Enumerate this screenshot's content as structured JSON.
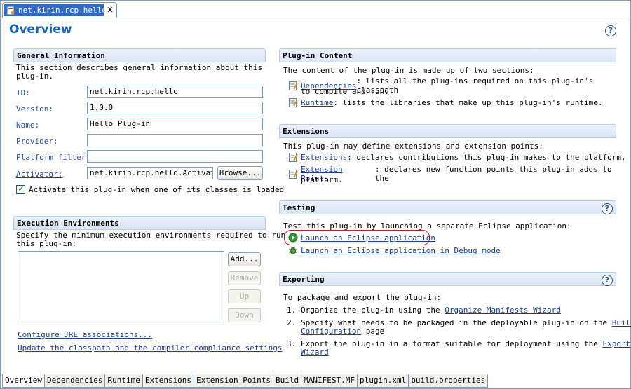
{
  "editor_tab": {
    "title": "net.kirin.rcp.hello",
    "close": "✕"
  },
  "page_title": "Overview",
  "help_glyph": "?",
  "general": {
    "title": "General Information",
    "desc_line1": "This section describes general information about this",
    "desc_line2": "plug-in.",
    "id_label": "ID:",
    "id_value": "net.kirin.rcp.hello",
    "version_label": "Version:",
    "version_value": "1.0.0",
    "name_label": "Name:",
    "name_value": "Hello Plug-in",
    "provider_label": "Provider:",
    "provider_value": "",
    "platform_label": "Platform filter:",
    "platform_value": "",
    "activator_label": "Activator:",
    "activator_value": "net.kirin.rcp.hello.Activator",
    "browse_label": "Browse...",
    "activate_label": "Activate this plug-in when one of its classes is loaded",
    "activate_checked": true
  },
  "execution": {
    "title": "Execution Environments",
    "desc_line1": "Specify the minimum execution environments required to run",
    "desc_line2": "this plug-in:",
    "add_label": "Add...",
    "remove_label": "Remove",
    "up_label": "Up",
    "down_label": "Down",
    "configure_link": "Configure JRE associations...",
    "update_link": "Update the classpath and the compiler compliance settings"
  },
  "content": {
    "title": "Plug-in Content",
    "intro": "The content of the plug-in is made up of two sections:",
    "dep_link": "Dependencies",
    "dep_text1": ": lists all the plug-ins required on this plug-in's classpath",
    "dep_text2": "to compile and run.",
    "runtime_link": "Runtime",
    "runtime_text": ": lists the libraries that make up this plug-in's runtime."
  },
  "extensions": {
    "title": "Extensions",
    "intro": "This plug-in may define extensions and extension points:",
    "ext_link": "Extensions",
    "ext_text": ": declares contributions this plug-in makes to the platform.",
    "extpt_link": "Extension Points",
    "extpt_text1": ": declares new function points this plug-in adds to the",
    "extpt_text2": "platform."
  },
  "testing": {
    "title": "Testing",
    "intro": "Test this plug-in by launching a separate Eclipse application:",
    "launch_link": "Launch an Eclipse application",
    "debug_link": "Launch an Eclipse application in Debug mode"
  },
  "exporting": {
    "title": "Exporting",
    "intro": "To package and export the plug-in:",
    "step1_num": "1.",
    "step1_text": "Organize the plug-in using the ",
    "step1_link": "Organize Manifests Wizard",
    "step2_num": "2.",
    "step2_text": "Specify what needs to be packaged in the deployable plug-in on the ",
    "step2_link1": "Build",
    "step2_link2": "Configuration",
    "step2_text2": " page",
    "step3_num": "3.",
    "step3_text": "Export the plug-in in a format suitable for deployment using the ",
    "step3_link1": "Export",
    "step3_link2": "Wizard"
  },
  "bottom_tabs": [
    "Overview",
    "Dependencies",
    "Runtime",
    "Extensions",
    "Extension Points",
    "Build",
    "MANIFEST.MF",
    "plugin.xml",
    "build.properties"
  ],
  "colors": {
    "title_blue": "#1660b7",
    "link_blue": "#1a3c8e",
    "highlight_red": "#d0141e",
    "tab_selected": "#316ac5"
  }
}
